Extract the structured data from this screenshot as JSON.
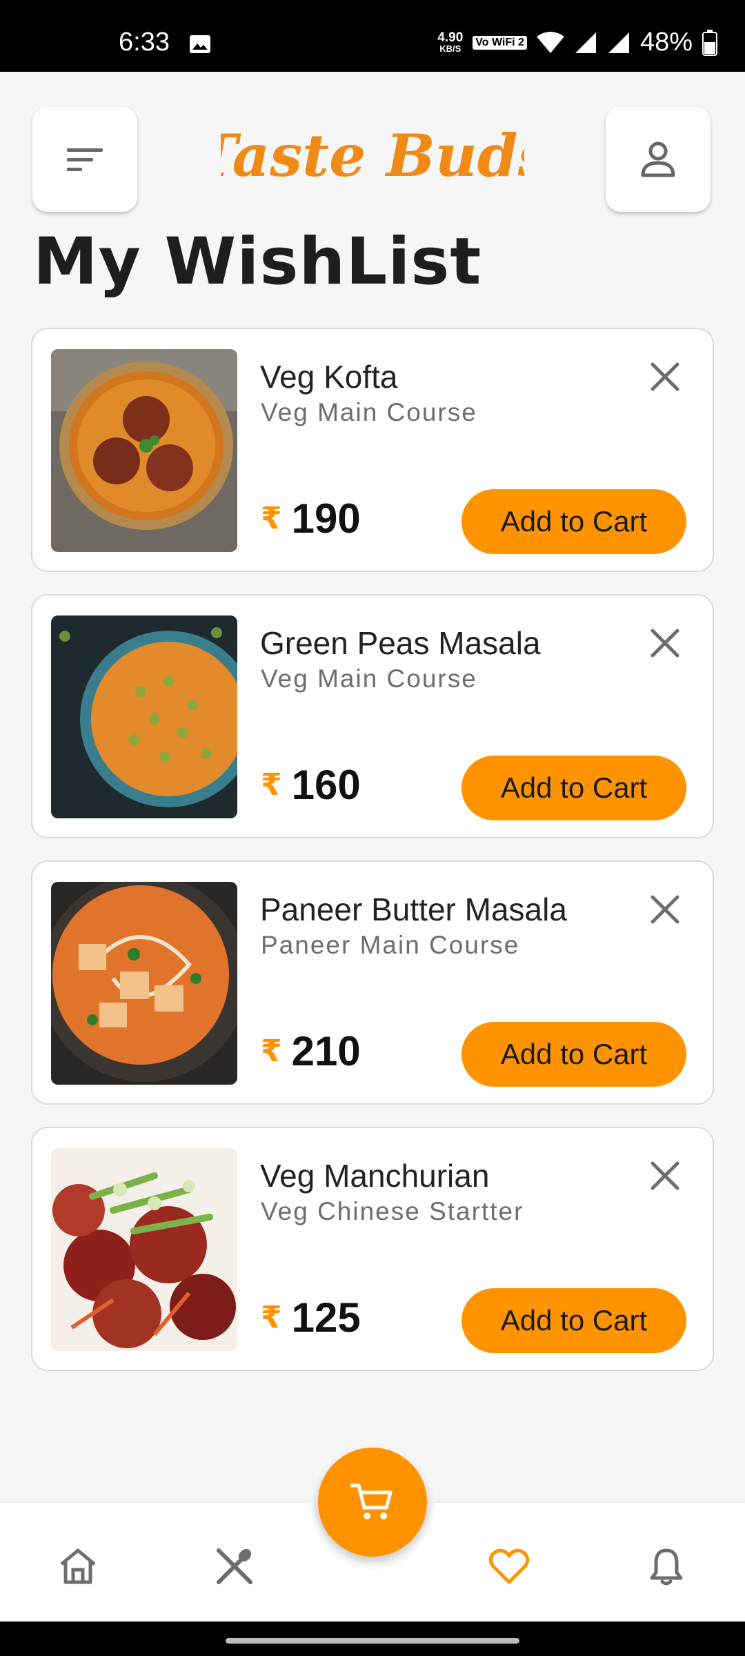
{
  "status_bar": {
    "time": "6:33",
    "speed_value": "4.90",
    "speed_unit": "KB/S",
    "vowifi": "Vo WiFi 2",
    "battery": "48%"
  },
  "header": {
    "brand": "Taste Buds",
    "menu_icon": "sort-lines-icon",
    "profile_icon": "person-icon"
  },
  "page": {
    "title": "My WishList"
  },
  "colors": {
    "accent": "#ff9400",
    "background": "#f6f6f7"
  },
  "wishlist": [
    {
      "name": "Veg Kofta",
      "category": "Veg Main Course",
      "currency": "₹",
      "price": "190",
      "button": "Add to Cart"
    },
    {
      "name": "Green Peas Masala",
      "category": "Veg Main Course",
      "currency": "₹",
      "price": "160",
      "button": "Add to Cart"
    },
    {
      "name": "Paneer Butter Masala",
      "category": "Paneer Main Course",
      "currency": "₹",
      "price": "210",
      "button": "Add to Cart"
    },
    {
      "name": "Veg Manchurian",
      "category": "Veg Chinese Startter",
      "currency": "₹",
      "price": "125",
      "button": "Add to Cart"
    }
  ],
  "bottom_nav": {
    "items": [
      "home-icon",
      "fork-spoon-icon",
      "heart-icon",
      "bell-icon"
    ],
    "active": "heart-icon",
    "fab_icon": "cart-icon"
  }
}
